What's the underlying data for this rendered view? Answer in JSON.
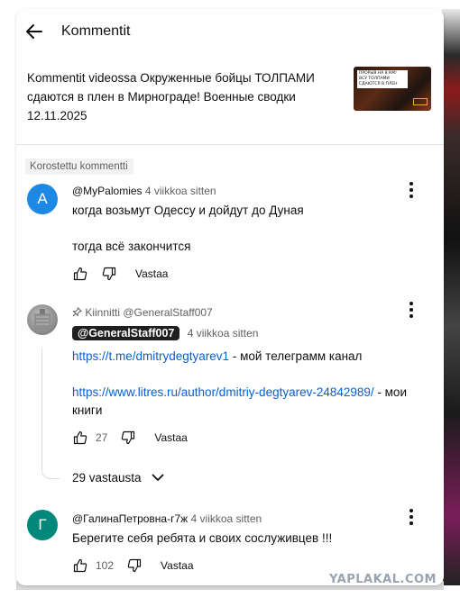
{
  "header": {
    "title": "Kommentit"
  },
  "video": {
    "title": "Kommentit videossa Окруженные бойцы ТОЛПАМИ сдаются в плен в Мирнограде! Военные сводки 12.11.2025",
    "thumbnail_caption": "ПРОРЫВ НА 8 КМ! ВСУ ТОЛПАМИ СДАЮТСЯ В ПЛЕН"
  },
  "highlighted_label": "Korostettu kommentti",
  "comments": [
    {
      "avatar_letter": "A",
      "avatar_color": "#1e88e5",
      "handle": "@MyPalomies",
      "time": "4 viikkoa sitten",
      "line1": "когда  возьмут Одессу и дойдут до Дуная",
      "line2": "тогда всё закончится",
      "likes": "",
      "reply_label": "Vastaa"
    },
    {
      "pinned_label": "Kiinnitti @GeneralStaff007",
      "handle": "@GeneralStaff007",
      "time": "4 viikkoa sitten",
      "link1": "https://t.me/dmitrydegtyarev1",
      "text1": " - мой телеграмм канал",
      "link2": "https://www.litres.ru/author/dmitriy-degtyarev-24842989/",
      "text2": " - мои книги",
      "likes": "27",
      "reply_label": "Vastaa",
      "replies_label": "29 vastausta"
    },
    {
      "avatar_letter": "Г",
      "avatar_color": "#00897b",
      "handle": "@ГалинаПетровна-г7ж",
      "time": "4 viikkoa sitten",
      "line1": "Берегите себя ребята и своих сослуживцев !!!",
      "likes": "102",
      "reply_label": "Vastaa"
    }
  ],
  "watermark": "YAPLAKAL.COM"
}
